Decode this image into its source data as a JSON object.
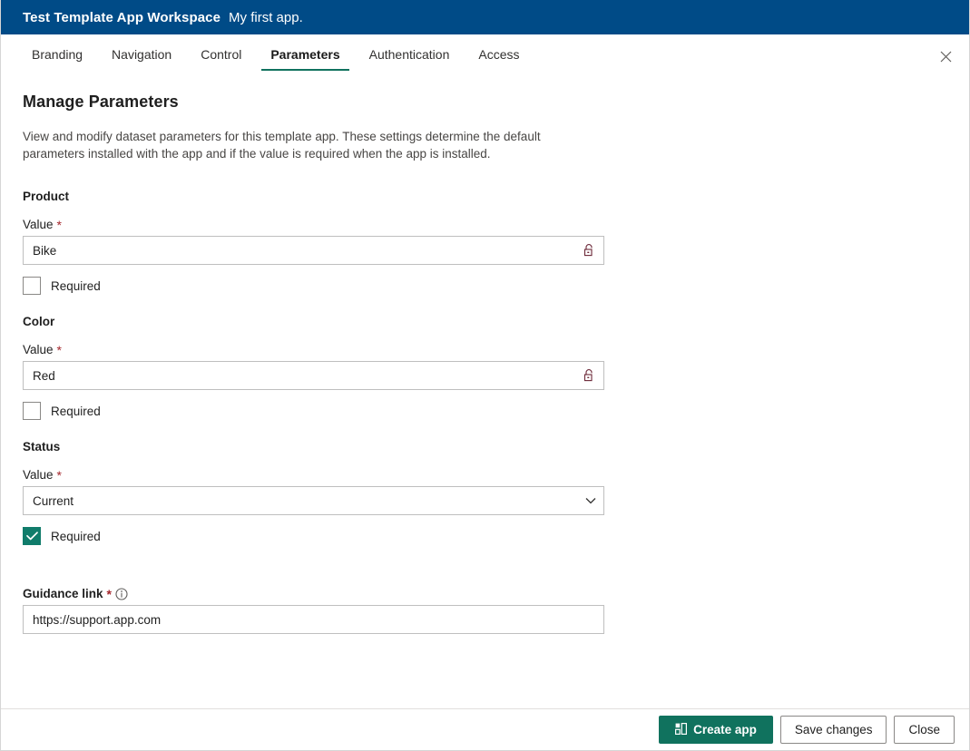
{
  "titlebar": {
    "workspace_name": "Test Template App Workspace",
    "app_name": "My first app.",
    "bg_color": "#004b87"
  },
  "tabs": [
    {
      "label": "Branding",
      "active": false
    },
    {
      "label": "Navigation",
      "active": false
    },
    {
      "label": "Control",
      "active": false
    },
    {
      "label": "Parameters",
      "active": true
    },
    {
      "label": "Authentication",
      "active": false
    },
    {
      "label": "Access",
      "active": false
    }
  ],
  "close_button": {
    "icon": "close-icon",
    "label": "✕"
  },
  "main": {
    "title": "Manage Parameters",
    "description": "View and modify dataset parameters for this template app. These settings determine the default parameters installed with the app and if the value is required when the app is installed.",
    "value_label": "Value",
    "required_marker": "*",
    "required_checkbox_label": "Required",
    "lock_icon": "unlock-icon",
    "chevron_icon": "chevron-down-icon"
  },
  "parameters": [
    {
      "name": "Product",
      "value_label": "Value",
      "value": "Bike",
      "control": "text",
      "locked": false,
      "required_label": "Required",
      "required": false
    },
    {
      "name": "Color",
      "value_label": "Value",
      "value": "Red",
      "control": "text",
      "locked": false,
      "required_label": "Required",
      "required": false
    },
    {
      "name": "Status",
      "value_label": "Value",
      "value": "Current",
      "control": "select",
      "options": [
        "Current"
      ],
      "required_label": "Required",
      "required": true
    }
  ],
  "guidance": {
    "label": "Guidance link",
    "required_marker": "*",
    "info_icon": "info-circle-icon",
    "value": "https://support.app.com",
    "placeholder": "https://support.app.com"
  },
  "footer": {
    "create_app": {
      "label": "Create app",
      "icon": "app-grid-icon"
    },
    "save_changes": {
      "label": "Save changes"
    },
    "close": {
      "label": "Close"
    }
  },
  "colors": {
    "header_blue": "#004b87",
    "accent_teal": "#10725e",
    "checkbox_checked": "#107c6b",
    "required_star": "#a4262c"
  }
}
